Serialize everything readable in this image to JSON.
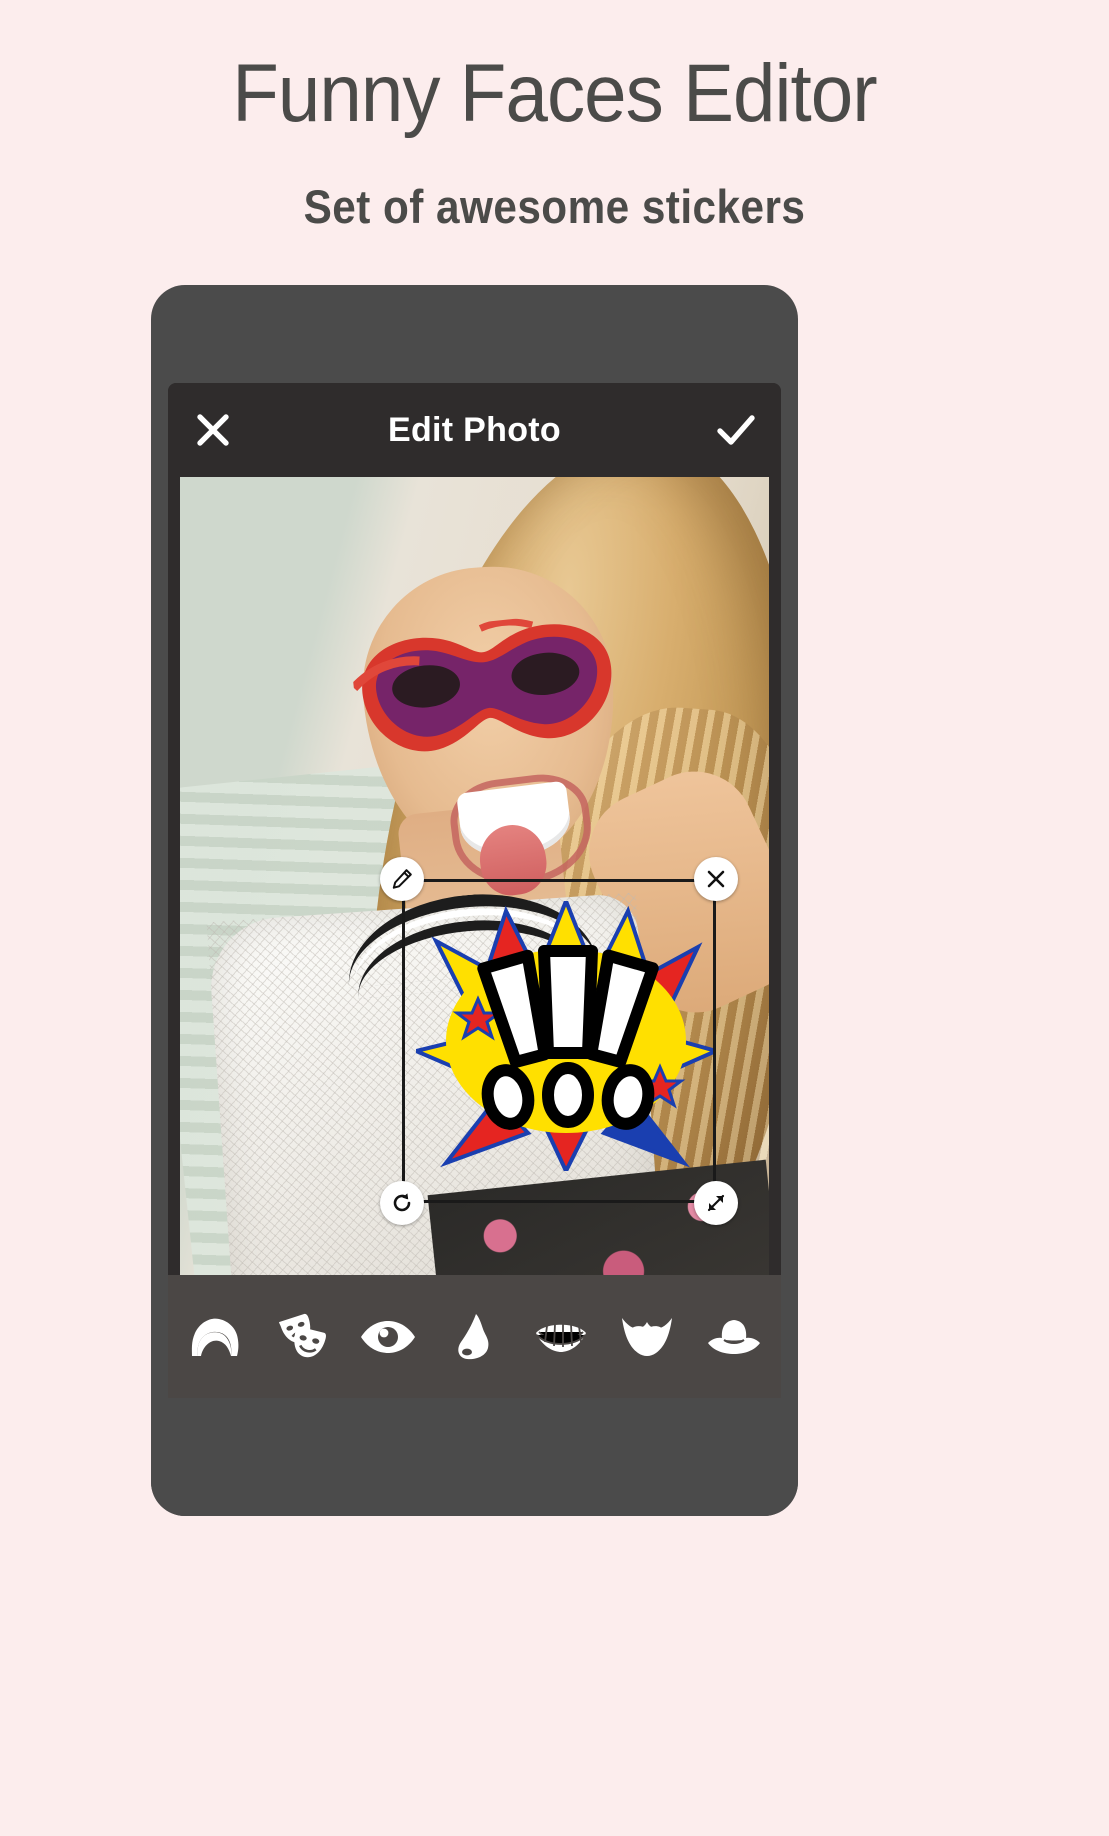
{
  "promo": {
    "title": "Funny Faces Editor",
    "subtitle": "Set of awesome stickers",
    "background_color": "#fceded",
    "text_color": "#4b4b49"
  },
  "app": {
    "header": {
      "title": "Edit Photo",
      "close_icon": "close-x-icon",
      "confirm_icon": "checkmark-icon",
      "background_color": "#2f2c2c",
      "text_color": "#ffffff"
    },
    "canvas": {
      "photo_description": "Selfie of a blonde woman wearing a red and purple masquerade mask, sticking her tongue out",
      "sticker": {
        "name": "comic-exclamation-sticker",
        "label": "!!!",
        "colors": [
          "#ffe000",
          "#e52521",
          "#1a3fb0",
          "#ffffff",
          "#000000"
        ],
        "selected": true,
        "handles": [
          {
            "name": "edit-handle",
            "icon": "pencil-icon",
            "position": "top-left"
          },
          {
            "name": "delete-handle",
            "icon": "close-x-icon",
            "position": "top-right"
          },
          {
            "name": "rotate-handle",
            "icon": "rotate-icon",
            "position": "bottom-left"
          },
          {
            "name": "resize-handle",
            "icon": "resize-arrow-icon",
            "position": "bottom-right"
          }
        ]
      }
    },
    "toolbar": {
      "background_color": "#4b4745",
      "items": [
        {
          "name": "hair-tool",
          "icon": "hair-icon",
          "label": "Hair"
        },
        {
          "name": "masks-tool",
          "icon": "theater-masks-icon",
          "label": "Masks"
        },
        {
          "name": "eyes-tool",
          "icon": "eye-icon",
          "label": "Eyes"
        },
        {
          "name": "nose-tool",
          "icon": "nose-icon",
          "label": "Nose"
        },
        {
          "name": "mouth-tool",
          "icon": "mouth-teeth-icon",
          "label": "Mouth"
        },
        {
          "name": "beard-tool",
          "icon": "beard-mustache-icon",
          "label": "Beard"
        },
        {
          "name": "hat-tool",
          "icon": "cowboy-hat-icon",
          "label": "Hat"
        }
      ]
    },
    "device": {
      "body_color": "#4b4b4b",
      "screen_color": "#2f2c2c"
    }
  }
}
